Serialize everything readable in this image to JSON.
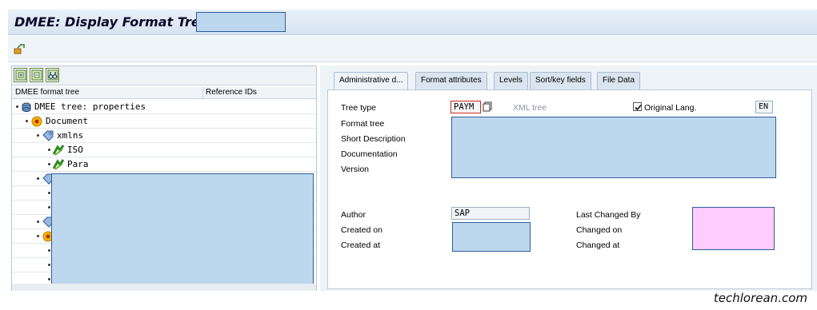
{
  "window": {
    "title": "DMEE: Display Format Tree"
  },
  "tree_panel": {
    "columns": [
      "DMEE format tree",
      "Reference IDs"
    ],
    "nodes": [
      {
        "label": "DMEE tree: properties",
        "icon": "tree-properties-icon"
      },
      {
        "label": "Document",
        "icon": "document-node-icon"
      },
      {
        "label": "xmlns",
        "icon": "tag-icon"
      },
      {
        "label": "ISO",
        "icon": "green-element-icon"
      },
      {
        "label": "Para",
        "icon": "green-element-icon"
      }
    ]
  },
  "tabs": [
    "Administrative d...",
    "Format attributes",
    "Levels",
    "Sort/key fields",
    "File Data"
  ],
  "admin": {
    "tree_type_label": "Tree type",
    "tree_type_value": "PAYM",
    "xml_tree_label": "XML tree",
    "original_lang_label": "Original Lang.",
    "original_lang_checked": true,
    "lang_value": "EN",
    "format_tree_label": "Format tree",
    "short_desc_label": "Short Description",
    "documentation_label": "Documentation",
    "version_label": "Version",
    "author_label": "Author",
    "author_value": "SAP",
    "created_on_label": "Created on",
    "created_at_label": "Created at",
    "last_changed_by_label": "Last Changed By",
    "changed_on_label": "Changed on",
    "changed_at_label": "Changed at"
  },
  "watermark": "techlorean.com",
  "colors": {
    "redaction_blue": "#bdd7ee",
    "redaction_pink": "#ffccff",
    "accent_border": "#2e5d9a"
  }
}
